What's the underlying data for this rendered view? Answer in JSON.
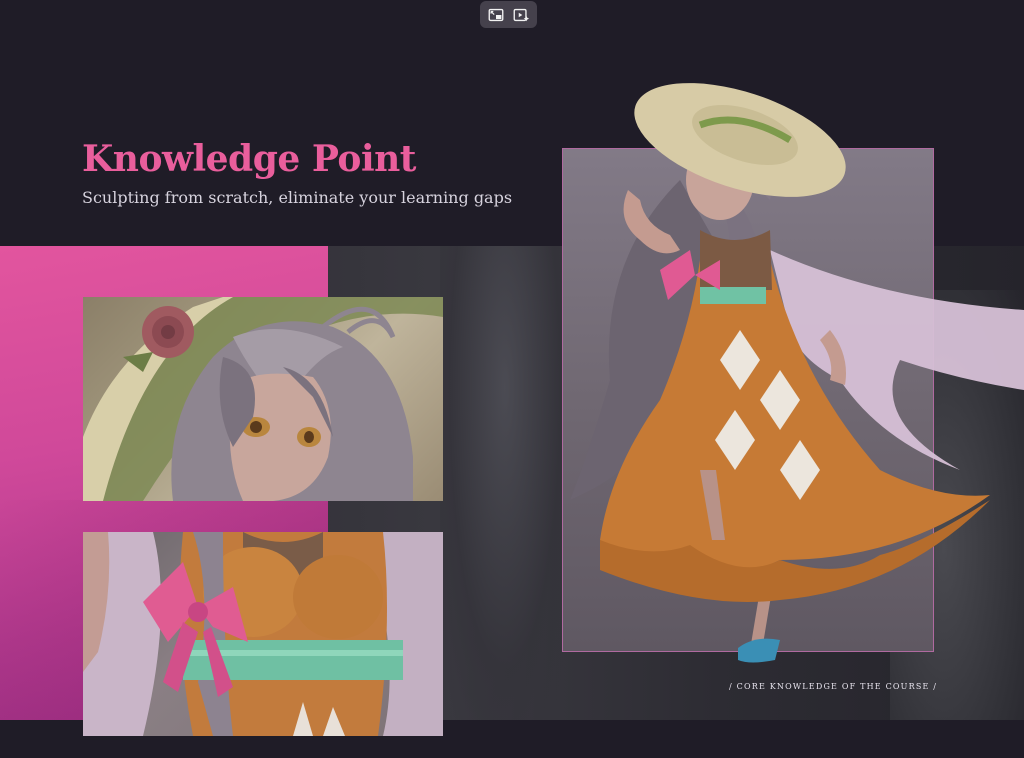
{
  "toolbar": {
    "buttons": [
      {
        "icon": "picture-in-picture-icon"
      },
      {
        "icon": "play-sparkle-icon"
      }
    ]
  },
  "hero": {
    "title": "Knowledge Point",
    "subtitle": "Sculpting from scratch, eliminate your learning gaps"
  },
  "caption": "/ CORE KNOWLEDGE OF THE COURSE /",
  "colors": {
    "background": "#1f1c27",
    "accent_pink": "#e95e9c",
    "panel_pink": "#d0499a",
    "frame_border": "#b06aa0"
  }
}
